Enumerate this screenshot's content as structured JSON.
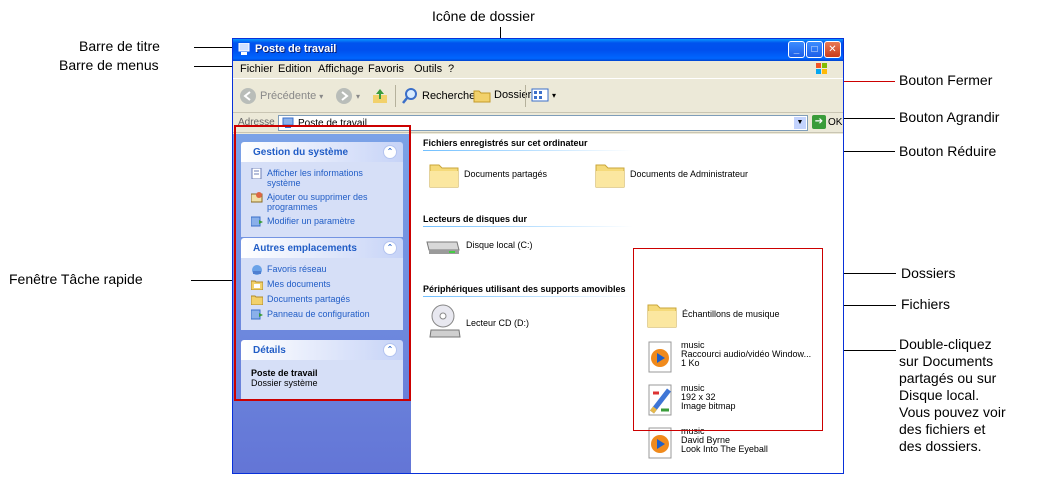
{
  "callouts": {
    "title_bar": "Barre de titre",
    "menu_bar": "Barre de menus",
    "folder_icon": "Icône de dossier",
    "close_button": "Bouton Fermer",
    "maximize_button": "Bouton Agrandir",
    "minimize_button": "Bouton Réduire",
    "task_pane": "Fenêtre Tâche rapide",
    "folders": "Dossiers",
    "files": "Fichiers",
    "double_click_lines": [
      "Double-cliquez",
      "sur Documents",
      "partagés ou sur",
      "Disque local.",
      "Vous pouvez voir",
      "des fichiers et",
      "des dossiers."
    ]
  },
  "window": {
    "title": "Poste de travail",
    "menu": [
      "Fichier",
      "Edition",
      "Affichage",
      "Favoris",
      "Outils",
      "?"
    ],
    "toolbar": {
      "back": "Précédente",
      "search": "Rechercher",
      "folders": "Dossiers"
    },
    "address": {
      "label": "Adresse",
      "value": "Poste de travail",
      "go": "OK"
    }
  },
  "taskpane": {
    "system": {
      "title": "Gestion du système",
      "items": [
        "Afficher les informations système",
        "Ajouter ou supprimer des programmes",
        "Modifier un paramètre"
      ]
    },
    "places": {
      "title": "Autres emplacements",
      "items": [
        "Favoris réseau",
        "Mes documents",
        "Documents partagés",
        "Panneau de configuration"
      ]
    },
    "details": {
      "title": "Détails",
      "name": "Poste de travail",
      "type": "Dossier système"
    }
  },
  "content": {
    "group_files": "Fichiers enregistrés sur cet ordinateur",
    "shared_docs": "Documents partagés",
    "admin_docs": "Documents de Administrateur",
    "group_drives": "Lecteurs de disques dur",
    "local_disk": "Disque local (C:)",
    "group_removable": "Périphériques utilisant des supports amovibles",
    "cd_drive": "Lecteur CD (D:)",
    "samples_folder": "Échantillons de musique",
    "files": [
      {
        "name": "music",
        "line1": "Raccourci audio/vidéo Window...",
        "line2": "1 Ko",
        "icon": "media-player-icon"
      },
      {
        "name": "music",
        "line1": "192 x 32",
        "line2": "Image bitmap",
        "icon": "bitmap-icon"
      },
      {
        "name": "music",
        "line1": "David Byrne",
        "line2": "Look Into The Eyeball",
        "icon": "media-player-icon"
      }
    ]
  }
}
